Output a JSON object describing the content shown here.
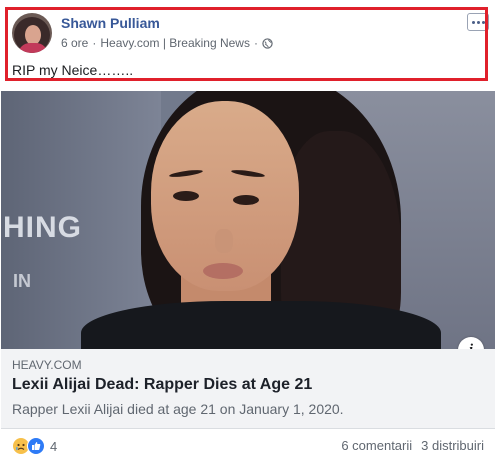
{
  "post": {
    "author": "Shawn Pulliam",
    "time": "6 ore",
    "via": "Heavy.com | Breaking News",
    "separator": "·",
    "privacy_icon": "globe-icon",
    "text": "RIP my Neice……..",
    "more_icon": "more-options-icon"
  },
  "photo": {
    "wall_text_large": "HING",
    "wall_text_small": "IN"
  },
  "link": {
    "domain": "HEAVY.COM",
    "title": "Lexii Alijai Dead: Rapper Dies at Age 21",
    "description": "Rapper Lexii Alijai died at age 21 on January 1, 2020.",
    "info_label": "i"
  },
  "footer": {
    "reaction_count": "4",
    "comments": "6 comentarii",
    "shares": "3 distribuiri",
    "reaction_icons": [
      "sad-reaction-icon",
      "like-reaction-icon"
    ]
  },
  "colors": {
    "author": "#385898",
    "highlight": "#e0202b",
    "link_bg": "#f2f3f5"
  }
}
